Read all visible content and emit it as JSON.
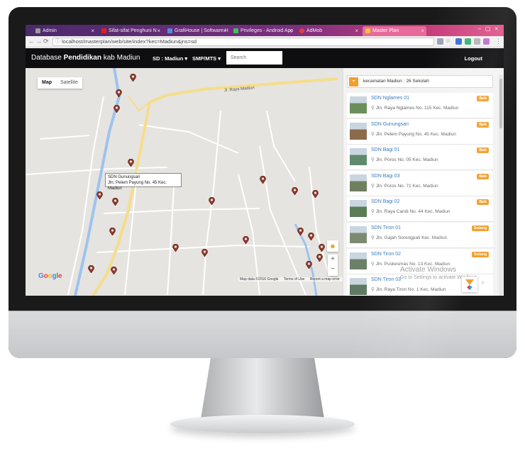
{
  "browser": {
    "tabs": [
      {
        "title": "Admin",
        "color": "#9b9b9b"
      },
      {
        "title": "Sifat-sifat Penghuni N",
        "color": "#e02020"
      },
      {
        "title": "GrafiHouse | Software H",
        "color": "#4a8fe0"
      },
      {
        "title": "Privileges - Android App",
        "color": "#3fbf5f"
      },
      {
        "title": "AdMob",
        "color": "#e04040"
      },
      {
        "title": "Master Plan",
        "color": "#f3c23a"
      }
    ],
    "active_tab": 5,
    "url": "localhost/masterplan/web/site/index?kec=Madiun&jns=sd"
  },
  "app": {
    "brand_prefix": "Database ",
    "brand_bold": "Pendidikan",
    "brand_suffix": " kab Madiun",
    "menu_sd": "SD : Madiun ▾",
    "menu_smp": "SMP/MTS ▾",
    "search_placeholder": "Search",
    "logout": "Logout"
  },
  "map": {
    "type_map": "Map",
    "type_satellite": "Satellite",
    "road_label": "Jl. Raya Madiun",
    "info_name": "SDN Gunungsari",
    "info_addr": "Jln. Pelem Payung No. 45 Kec. Madiun",
    "logo": "Google",
    "footer_data": "Map data ©2016 Google",
    "footer_terms": "Terms of Use",
    "footer_report": "Report a map error",
    "zoom_in": "+",
    "zoom_out": "−"
  },
  "sidebar": {
    "filter_text": "kecamatan Madiun : 26 Sekolah",
    "schools": [
      {
        "name": "SDN Nglames 01",
        "addr": "Jln. Raya Nglames No. 115 Kec. Madiun",
        "badge": "Baik",
        "badge_color": "#f0a030"
      },
      {
        "name": "SDN Gunungsari",
        "addr": "Jln. Pelem Payung No. 45 Kec. Madiun",
        "badge": "Baik",
        "badge_color": "#f0a030"
      },
      {
        "name": "SDN Bagi 01",
        "addr": "Jln. Poros No. 05 Kec. Madiun",
        "badge": "Baik",
        "badge_color": "#f0a030"
      },
      {
        "name": "SDN Bagi 03",
        "addr": "Jln. Poros No. 71 Kec. Madiun",
        "badge": "Baik",
        "badge_color": "#f0a030"
      },
      {
        "name": "SDN Bagi 02",
        "addr": "Jln. Raya Candi No. 44 Kec. Madiun",
        "badge": "Baik",
        "badge_color": "#f0a030"
      },
      {
        "name": "SDN Tiron 01",
        "addr": "Jln. Gajah Sorengpati Kec. Madiun",
        "badge": "Sedang",
        "badge_color": "#f0a030"
      },
      {
        "name": "SDN Tiron 02",
        "addr": "Jln. Puskesmas No. 13 Kec. Madiun",
        "badge": "Sedang",
        "badge_color": "#f0a030"
      },
      {
        "name": "SDN Tiron 03",
        "addr": "Jln. Raya Tiron No. 1 Kec. Madiun",
        "badge": "",
        "badge_color": "#f0a030"
      }
    ]
  },
  "watermark": {
    "line1": "Activate Windows",
    "line2": "Go to Settings to activate Windows."
  }
}
